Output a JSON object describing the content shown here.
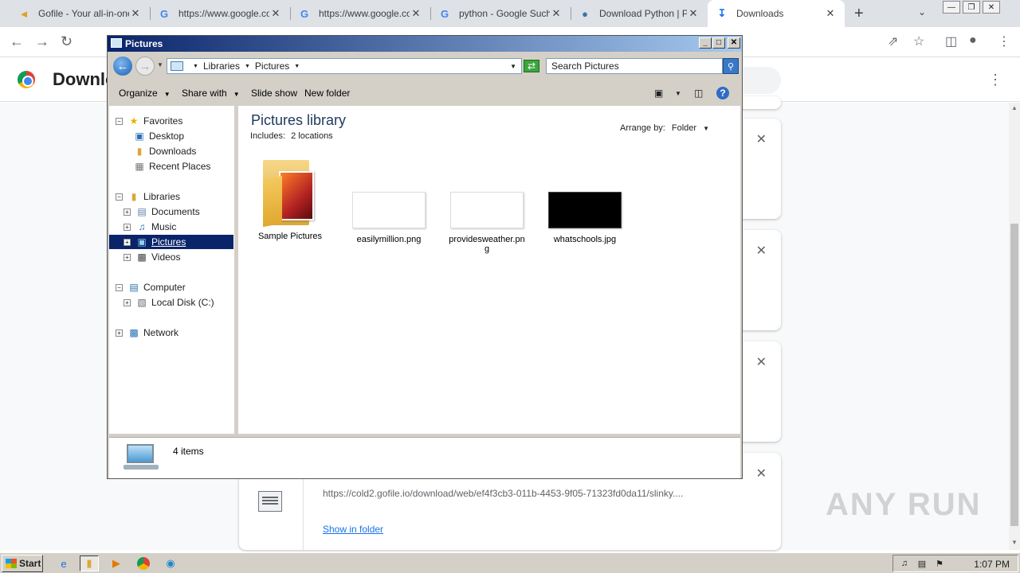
{
  "browser": {
    "tabs": [
      {
        "title": "Gofile - Your all-in-one",
        "icon": "gofile-icon"
      },
      {
        "title": "https://www.google.co",
        "icon": "google-icon"
      },
      {
        "title": "https://www.google.co",
        "icon": "google-icon"
      },
      {
        "title": "python - Google Suche",
        "icon": "google-icon"
      },
      {
        "title": "Download Python | PyP",
        "icon": "python-icon"
      },
      {
        "title": "Downloads",
        "icon": "download-icon",
        "active": true
      }
    ],
    "downloads_page_title": "Downloads",
    "download_card": {
      "url": "https://cold2.gofile.io/download/web/ef4f3cb3-011b-4453-9f05-71323fd0da11/slinky....",
      "show_in_folder": "Show in folder"
    },
    "watermark": "ANY RUN"
  },
  "explorer": {
    "window_title": "Pictures",
    "breadcrumb": [
      "Libraries",
      "Pictures"
    ],
    "search_placeholder": "Search Pictures",
    "commands": {
      "organize": "Organize",
      "share_with": "Share with",
      "slide_show": "Slide show",
      "new_folder": "New folder"
    },
    "nav": {
      "favorites": "Favorites",
      "desktop": "Desktop",
      "downloads": "Downloads",
      "recent_places": "Recent Places",
      "libraries": "Libraries",
      "documents": "Documents",
      "music": "Music",
      "pictures": "Pictures",
      "videos": "Videos",
      "computer": "Computer",
      "local_disk": "Local Disk (C:)",
      "network": "Network"
    },
    "library_title": "Pictures library",
    "includes_label": "Includes:",
    "includes_value": "2 locations",
    "arrange_label": "Arrange by:",
    "arrange_value": "Folder",
    "items": [
      {
        "name": "Sample Pictures",
        "kind": "folder"
      },
      {
        "name": "easilymillion.png",
        "kind": "image-light"
      },
      {
        "name": "providesweather.png",
        "kind": "image-light"
      },
      {
        "name": "whatschools.jpg",
        "kind": "image-dark"
      }
    ],
    "status": "4 items"
  },
  "taskbar": {
    "start_label": "Start",
    "clock": "1:07 PM"
  }
}
